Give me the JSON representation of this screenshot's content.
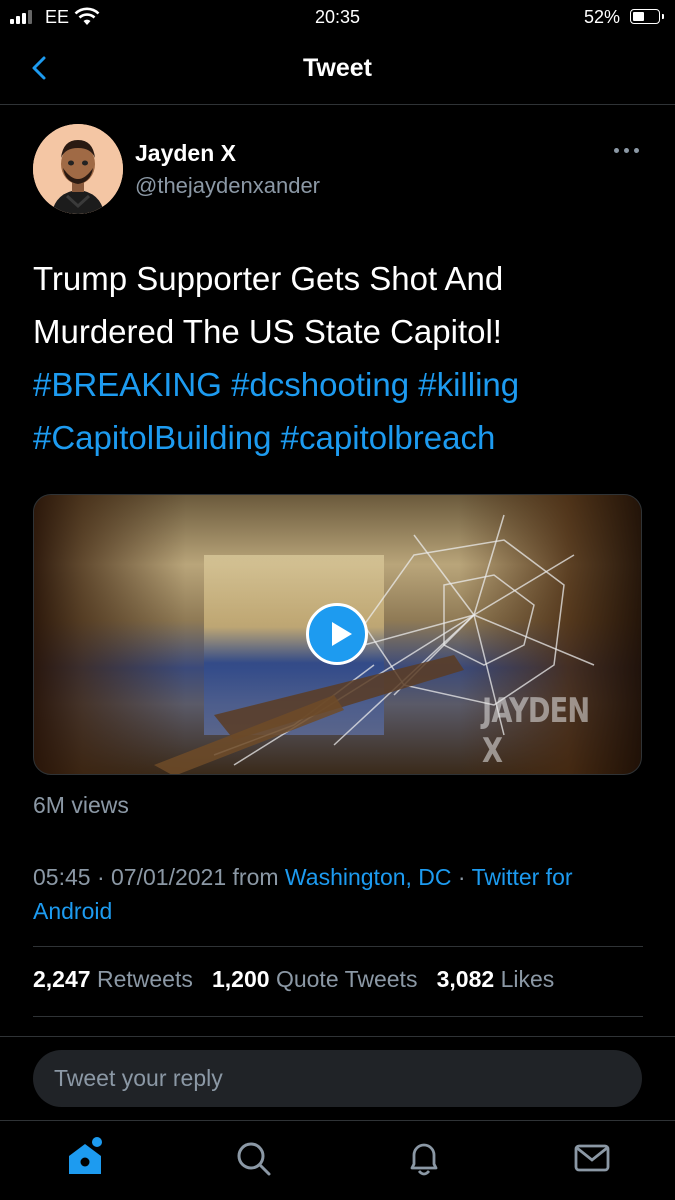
{
  "status_bar": {
    "carrier": "EE",
    "time": "20:35",
    "battery": "52%",
    "battery_level": 0.52,
    "signal_bars": 3
  },
  "nav": {
    "title": "Tweet",
    "back_icon": "chevron-left-icon"
  },
  "author": {
    "name": "Jayden X",
    "handle": "@thejaydenxander",
    "more_icon": "more-horizontal-icon"
  },
  "tweet": {
    "text": "Trump Supporter Gets Shot And Murdered The US State Capitol!",
    "hashtags": [
      "#BREAKING",
      "#dcshooting",
      "#killing",
      "#CapitolBuilding",
      "#capitolbreach"
    ],
    "media": {
      "watermark": "JAYDEN X",
      "play_icon": "play-icon"
    },
    "views": "6M views",
    "time": "05:45",
    "date": "07/01/2021",
    "from_label": "from",
    "location": "Washington, DC",
    "source": "Twitter for Android"
  },
  "stats": {
    "retweets_count": "2,247",
    "retweets_label": "Retweets",
    "quotes_count": "1,200",
    "quotes_label": "Quote Tweets",
    "likes_count": "3,082",
    "likes_label": "Likes"
  },
  "reply": {
    "placeholder": "Tweet your reply"
  },
  "tab_bar": {
    "icons": [
      "home-icon",
      "search-icon",
      "notifications-icon",
      "messages-icon"
    ],
    "accent": "#1d9bf0",
    "muted": "#8b98a5"
  },
  "colors": {
    "background": "#000000",
    "accent": "#1d9bf0",
    "secondary_text": "#8b98a5",
    "divider": "#2f3336"
  }
}
